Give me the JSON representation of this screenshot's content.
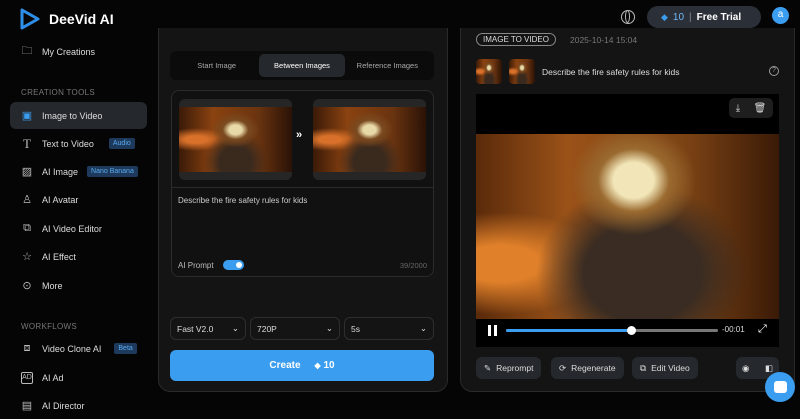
{
  "app": {
    "name": "DeeVid AI"
  },
  "header": {
    "credits": "10",
    "plan": "Free Trial",
    "avatar": "a"
  },
  "sidebar": {
    "my_creations": "My Creations",
    "creation_tools_label": "CREATION TOOLS",
    "items": [
      {
        "label": "Image to Video"
      },
      {
        "label": "Text to Video",
        "badge": "Audio"
      },
      {
        "label": "AI Image",
        "badge": "Nano Banana"
      },
      {
        "label": "AI Avatar"
      },
      {
        "label": "AI Video Editor"
      },
      {
        "label": "AI Effect"
      },
      {
        "label": "More"
      }
    ],
    "workflows_label": "WORKFLOWS",
    "workflows": [
      {
        "label": "Video Clone AI",
        "badge": "Beta"
      },
      {
        "label": "AI Ad"
      },
      {
        "label": "AI Director"
      }
    ]
  },
  "editor": {
    "tabs": [
      "Start Image",
      "Between Images",
      "Reference Images"
    ],
    "active_tab": 1,
    "prompt": "Describe the fire safety rules for kids",
    "ai_prompt_label": "AI Prompt",
    "ai_prompt_on": true,
    "char_count": "39/2000",
    "model": "Fast V2.0",
    "resolution": "720P",
    "duration": "5s",
    "create_label": "Create",
    "create_cost": "10"
  },
  "result": {
    "type_badge": "IMAGE TO VIDEO",
    "timestamp": "2025-10-14 15:04",
    "prompt": "Describe the fire safety rules for kids",
    "time_remaining": "-00:01",
    "progress": 0.59,
    "actions": [
      "Reprompt",
      "Regenerate",
      "Edit Video"
    ]
  },
  "colors": {
    "accent": "#3b9df0",
    "bg": "#050505",
    "panel": "#141414"
  }
}
